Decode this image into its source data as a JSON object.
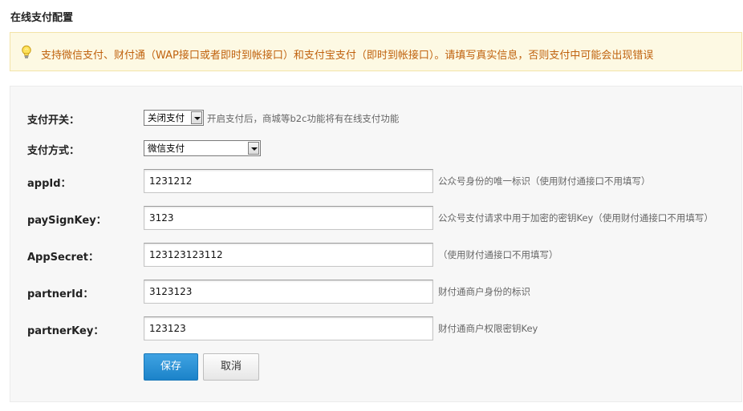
{
  "page": {
    "title": "在线支付配置"
  },
  "notice": {
    "icon": "lightbulb-icon",
    "text": "支持微信支付、财付通（WAP接口或者即时到帐接口）和支付宝支付（即时到帐接口）。请填写真实信息，否则支付中可能会出现错误",
    "text_color": "#c0620e"
  },
  "form": {
    "payment_switch": {
      "label": "支付开关：",
      "selected": "关闭支付",
      "hint": "开启支付后，商城等b2c功能将有在线支付功能"
    },
    "payment_method": {
      "label": "支付方式：",
      "selected": "微信支付"
    },
    "app_id": {
      "label": "appId：",
      "value": "1231212",
      "hint": "公众号身份的唯一标识（使用财付通接口不用填写）"
    },
    "pay_sign_key": {
      "label": "paySignKey：",
      "value": "3123",
      "hint": "公众号支付请求中用于加密的密钥Key（使用财付通接口不用填写）"
    },
    "app_secret": {
      "label": "AppSecret：",
      "value": "123123123112",
      "hint": "（使用财付通接口不用填写）"
    },
    "partner_id": {
      "label": "partnerId：",
      "value": "3123123",
      "hint": "财付通商户身份的标识"
    },
    "partner_key": {
      "label": "partnerKey：",
      "value": "123123",
      "hint": "财付通商户权限密钥Key"
    }
  },
  "buttons": {
    "save_label": "保存",
    "cancel_label": "取消",
    "save_color": "#2a8fd6"
  }
}
